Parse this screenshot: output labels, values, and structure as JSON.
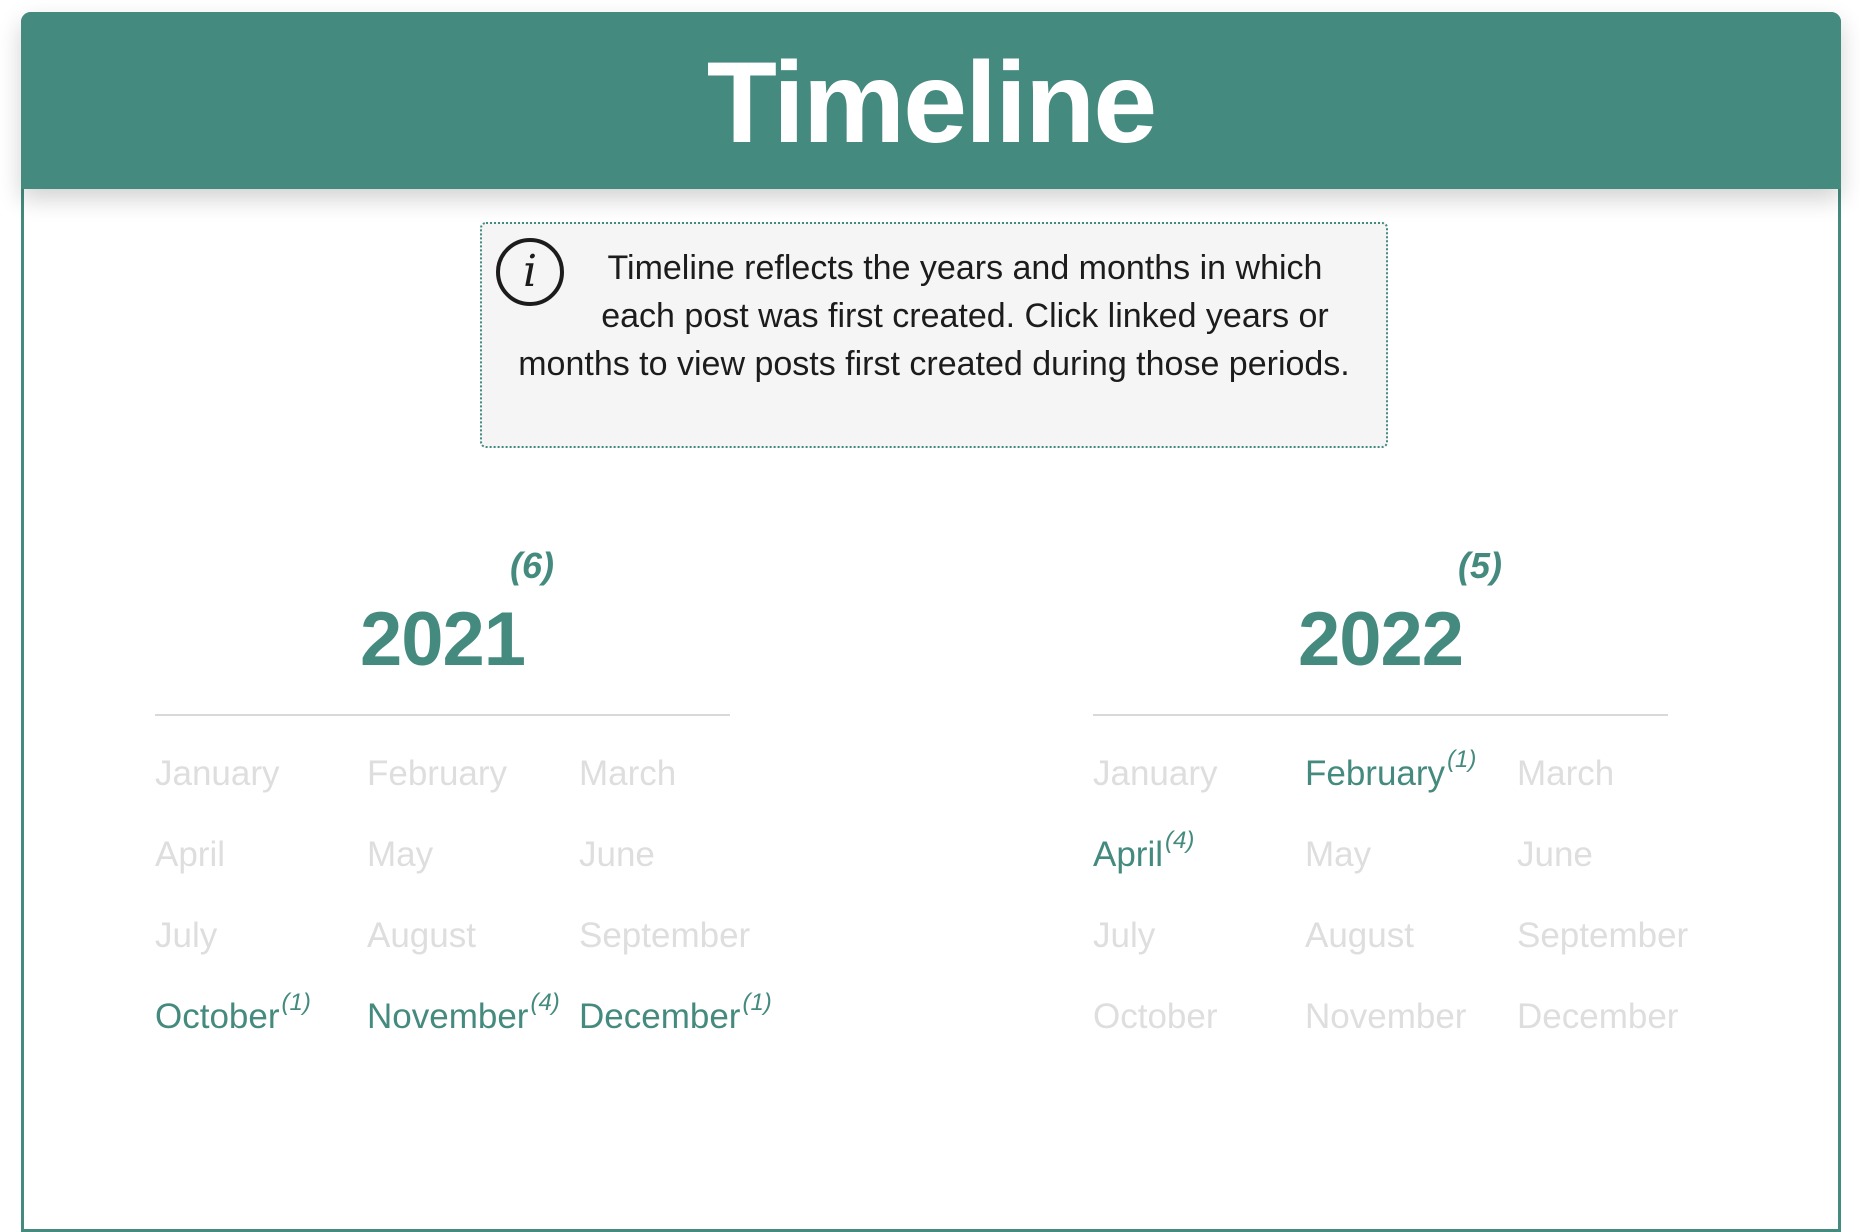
{
  "header": {
    "title": "Timeline"
  },
  "info": {
    "icon": "info-icon",
    "icon_glyph": "i",
    "text": "Timeline reflects the years and months in which each post was first created. Click linked years or months to view posts first created during those periods."
  },
  "years": [
    {
      "year": "2021",
      "count": "(6)",
      "months": [
        {
          "name": "January",
          "count": "",
          "active": false
        },
        {
          "name": "February",
          "count": "",
          "active": false
        },
        {
          "name": "March",
          "count": "",
          "active": false
        },
        {
          "name": "April",
          "count": "",
          "active": false
        },
        {
          "name": "May",
          "count": "",
          "active": false
        },
        {
          "name": "June",
          "count": "",
          "active": false
        },
        {
          "name": "July",
          "count": "",
          "active": false
        },
        {
          "name": "August",
          "count": "",
          "active": false
        },
        {
          "name": "September",
          "count": "",
          "active": false
        },
        {
          "name": "October",
          "count": "(1)",
          "active": true
        },
        {
          "name": "November",
          "count": "(4)",
          "active": true
        },
        {
          "name": "December",
          "count": "(1)",
          "active": true
        }
      ]
    },
    {
      "year": "2022",
      "count": "(5)",
      "months": [
        {
          "name": "January",
          "count": "",
          "active": false
        },
        {
          "name": "February",
          "count": "(1)",
          "active": true
        },
        {
          "name": "March",
          "count": "",
          "active": false
        },
        {
          "name": "April",
          "count": "(4)",
          "active": true
        },
        {
          "name": "May",
          "count": "",
          "active": false
        },
        {
          "name": "June",
          "count": "",
          "active": false
        },
        {
          "name": "July",
          "count": "",
          "active": false
        },
        {
          "name": "August",
          "count": "",
          "active": false
        },
        {
          "name": "September",
          "count": "",
          "active": false
        },
        {
          "name": "October",
          "count": "",
          "active": false
        },
        {
          "name": "November",
          "count": "",
          "active": false
        },
        {
          "name": "December",
          "count": "",
          "active": false
        }
      ]
    }
  ],
  "colors": {
    "accent": "#458a7e",
    "inactive_month": "#dedede",
    "info_background": "#f5f5f5",
    "text": "#1c1c1c"
  }
}
